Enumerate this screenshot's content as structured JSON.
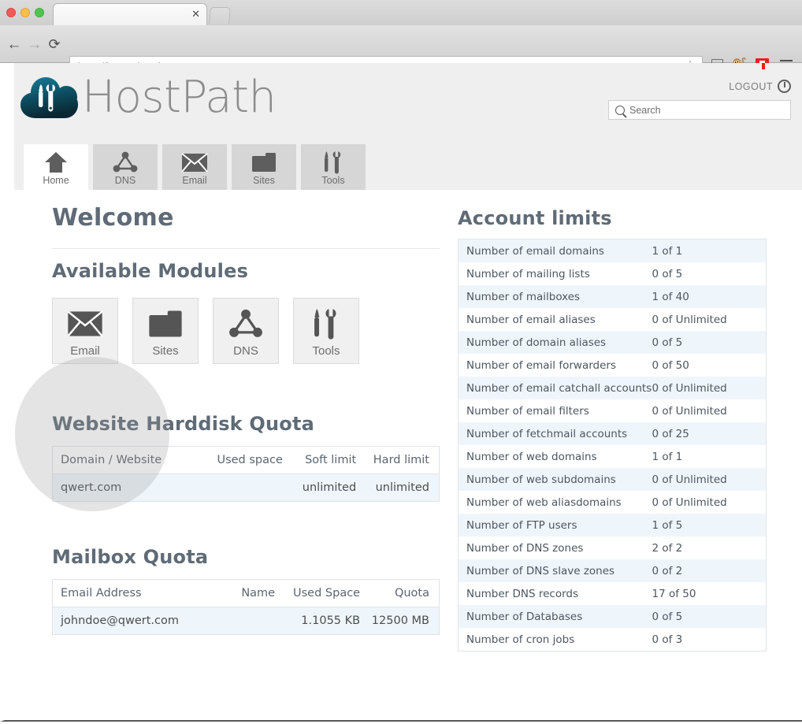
{
  "browser": {
    "tab_title": "",
    "tab_close_icon": "close-icon",
    "url": "https://hostpath.pathcom.com",
    "back_glyph": "←",
    "forward_glyph": "→",
    "reload_glyph": "⟳",
    "star_glyph": "☆",
    "extension_glyph": "🐒",
    "icons": [
      "bookmark-star-icon",
      "cast-icon",
      "extension-emoji-icon",
      "flipboard-icon",
      "menu-hamburger-icon"
    ]
  },
  "header": {
    "brand_name": "HostPath",
    "logout_label": "LOGOUT",
    "search_placeholder": "Search",
    "search_value": ""
  },
  "nav_tabs": [
    {
      "label": "Home",
      "icon": "home-icon",
      "active": true
    },
    {
      "label": "DNS",
      "icon": "dns-network-icon",
      "active": false
    },
    {
      "label": "Email",
      "icon": "envelope-icon",
      "active": false
    },
    {
      "label": "Sites",
      "icon": "folder-icon",
      "active": false
    },
    {
      "label": "Tools",
      "icon": "tools-icon",
      "active": false
    }
  ],
  "main": {
    "welcome_title": "Welcome",
    "available_modules_title": "Available Modules",
    "modules": [
      {
        "label": "Email",
        "icon": "envelope-icon"
      },
      {
        "label": "Sites",
        "icon": "folder-icon"
      },
      {
        "label": "DNS",
        "icon": "dns-network-icon"
      },
      {
        "label": "Tools",
        "icon": "tools-icon"
      }
    ],
    "website_quota": {
      "title": "Website Harddisk Quota",
      "columns": [
        "Domain / Website",
        "Used space",
        "Soft limit",
        "Hard limit"
      ],
      "rows": [
        [
          "qwert.com",
          "",
          "unlimited",
          "unlimited"
        ]
      ]
    },
    "mailbox_quota": {
      "title": "Mailbox Quota",
      "columns": [
        "Email Address",
        "Name",
        "Used Space",
        "Quota"
      ],
      "rows": [
        [
          "johndoe@qwert.com",
          "",
          "1.1055 KB",
          "12500 MB"
        ]
      ]
    },
    "account_limits": {
      "title": "Account limits",
      "rows": [
        {
          "label": "Number of email domains",
          "value": "1 of 1"
        },
        {
          "label": "Number of mailing lists",
          "value": "0 of 5"
        },
        {
          "label": "Number of mailboxes",
          "value": "1 of 40"
        },
        {
          "label": "Number of email aliases",
          "value": "0 of Unlimited"
        },
        {
          "label": "Number of domain aliases",
          "value": "0 of 5"
        },
        {
          "label": "Number of email forwarders",
          "value": "0 of 50"
        },
        {
          "label": "Number of email catchall accounts",
          "value": "0 of Unlimited"
        },
        {
          "label": "Number of email filters",
          "value": "0 of Unlimited"
        },
        {
          "label": "Number of fetchmail accounts",
          "value": "0 of 25"
        },
        {
          "label": "Number of web domains",
          "value": "1 of 1"
        },
        {
          "label": "Number of web subdomains",
          "value": "0 of Unlimited"
        },
        {
          "label": "Number of web aliasdomains",
          "value": "0 of Unlimited"
        },
        {
          "label": "Number of FTP users",
          "value": "1 of 5"
        },
        {
          "label": "Number of DNS zones",
          "value": "2 of 2"
        },
        {
          "label": "Number of DNS slave zones",
          "value": "0 of 2"
        },
        {
          "label": "Number DNS records",
          "value": "17 of 50"
        },
        {
          "label": "Number of Databases",
          "value": "0 of 5"
        },
        {
          "label": "Number of cron jobs",
          "value": "0 of 3"
        }
      ]
    }
  },
  "colors": {
    "header_band": "#efefef",
    "brand_text": "#8c8c8c",
    "heading": "#5f6b76",
    "tab_inactive": "#d6d6d6",
    "table_stripe": "#eff6fb",
    "table_border": "#dfe4e8",
    "flipboard_red": "#e5201f",
    "logo_teal": "#0d5f77"
  }
}
